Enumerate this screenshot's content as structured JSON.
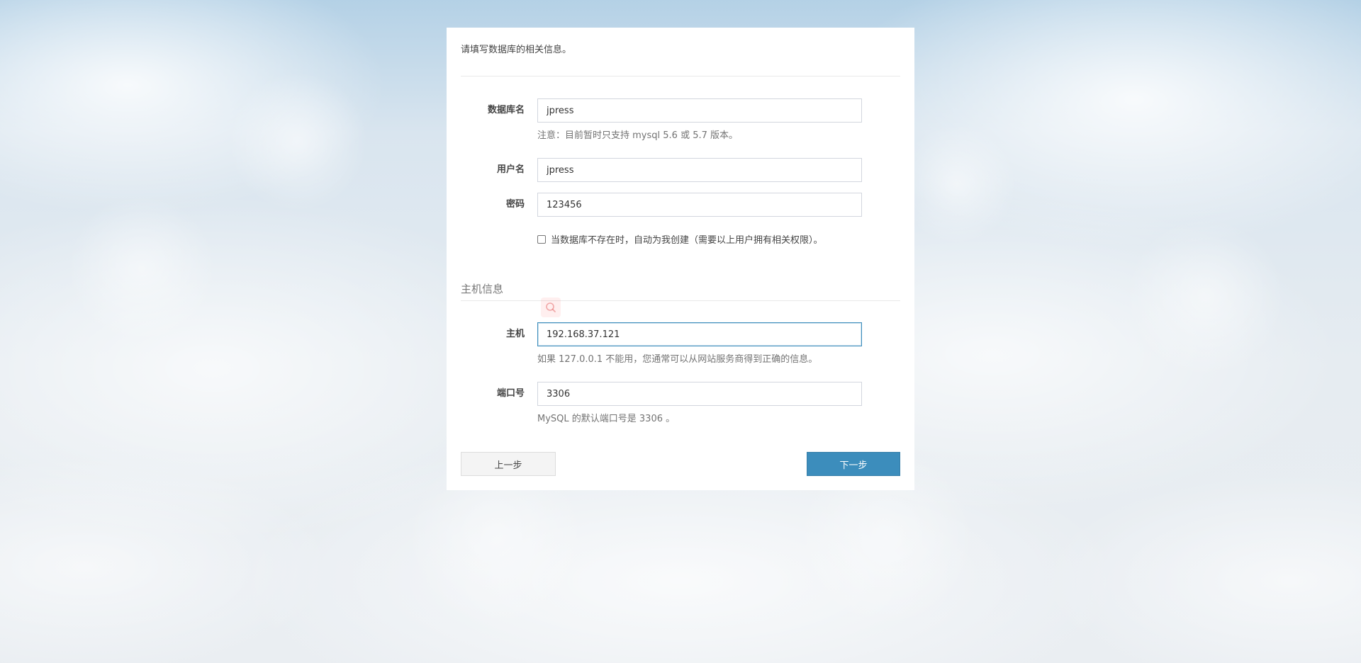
{
  "intro": "请填写数据库的相关信息。",
  "db": {
    "name_label": "数据库名",
    "name_value": "jpress",
    "name_help": "注意：目前暂时只支持 mysql 5.6 或 5.7 版本。",
    "user_label": "用户名",
    "user_value": "jpress",
    "password_label": "密码",
    "password_value": "123456",
    "create_checkbox_label": "当数据库不存在时，自动为我创建（需要以上用户拥有相关权限）。"
  },
  "host_section": {
    "title": "主机信息",
    "host_label": "主机",
    "host_value": "192.168.37.121",
    "host_help": "如果 127.0.0.1 不能用，您通常可以从网站服务商得到正确的信息。",
    "port_label": "端口号",
    "port_value": "3306",
    "port_help": "MySQL 的默认端口号是 3306 。"
  },
  "buttons": {
    "prev_label": "上一步",
    "next_label": "下一步"
  },
  "colors": {
    "primary": "#3c8dbc",
    "panel_bg": "#ffffff"
  }
}
